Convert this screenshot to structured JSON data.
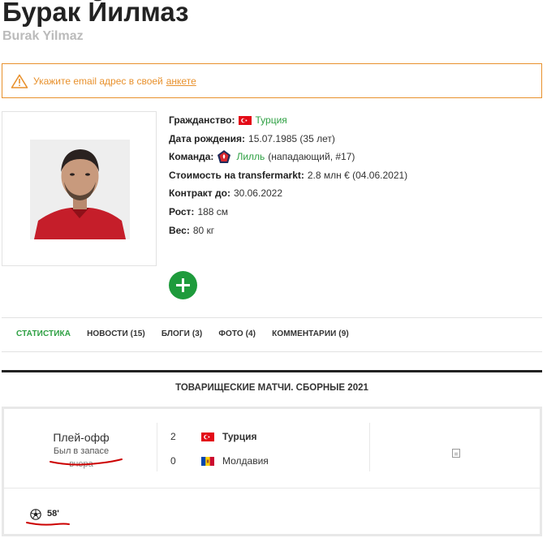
{
  "player": {
    "name": "Бурак Йилмаз",
    "name_latin": "Burak Yilmaz"
  },
  "alert": {
    "text": "Укажите email адрес в своей",
    "link": "анкете"
  },
  "info": {
    "citizenship_label": "Гражданство:",
    "citizenship_value": "Турция",
    "birth_label": "Дата рождения:",
    "birth_value": "15.07.1985 (35 лет)",
    "team_label": "Команда:",
    "team_name": "Лилль",
    "team_role": "(нападающий, #17)",
    "value_label": "Стоимость на transfermarkt:",
    "value_value": "2.8 млн € (04.06.2021)",
    "contract_label": "Контракт до:",
    "contract_value": "30.06.2022",
    "height_label": "Рост:",
    "height_value": "188 см",
    "weight_label": "Вес:",
    "weight_value": "80 кг"
  },
  "tabs": [
    "Статистика",
    "Новости (15)",
    "Блоги (3)",
    "Фото (4)",
    "Комментарии (9)"
  ],
  "section": {
    "title": "Товарищеские матчи. Сборные 2021"
  },
  "match": {
    "stage": "Плей-офф",
    "status": "Был в запасе",
    "date": "вчера",
    "home_score": "2",
    "home_team": "Турция",
    "away_score": "0",
    "away_team": "Молдавия",
    "minute": "58'"
  },
  "colors": {
    "accent_green": "#2ea043",
    "warning_orange": "#e8912d",
    "annotation_red": "#cc0000"
  }
}
